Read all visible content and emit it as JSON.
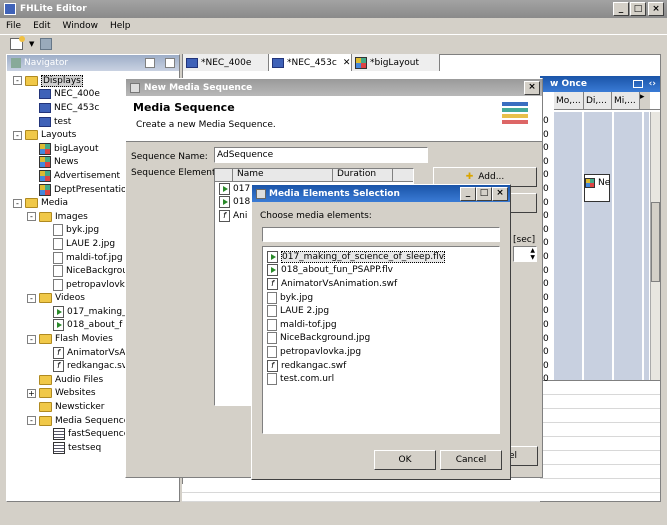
{
  "app_title": "FHLite Editor",
  "menu": [
    "File",
    "Edit",
    "Window",
    "Help"
  ],
  "navigator_label": "Navigator",
  "tree": [
    {
      "label": "Displays",
      "indent": 0,
      "icon": "folder",
      "exp": "-",
      "sel": true
    },
    {
      "label": "NEC_400e",
      "indent": 1,
      "icon": "monitor"
    },
    {
      "label": "NEC_453c",
      "indent": 1,
      "icon": "monitor"
    },
    {
      "label": "test",
      "indent": 1,
      "icon": "monitor"
    },
    {
      "label": "Layouts",
      "indent": 0,
      "icon": "folder",
      "exp": "-"
    },
    {
      "label": "bigLayout",
      "indent": 1,
      "icon": "layout"
    },
    {
      "label": "News",
      "indent": 1,
      "icon": "layout"
    },
    {
      "label": "Advertisement",
      "indent": 1,
      "icon": "layout"
    },
    {
      "label": "DeptPresentation",
      "indent": 1,
      "icon": "layout"
    },
    {
      "label": "Media",
      "indent": 0,
      "icon": "folder",
      "exp": "-"
    },
    {
      "label": "Images",
      "indent": 1,
      "icon": "folder",
      "exp": "-"
    },
    {
      "label": "byk.jpg",
      "indent": 2,
      "icon": "doc"
    },
    {
      "label": "LAUE 2.jpg",
      "indent": 2,
      "icon": "doc"
    },
    {
      "label": "maldi-tof.jpg",
      "indent": 2,
      "icon": "doc"
    },
    {
      "label": "NiceBackgrou",
      "indent": 2,
      "icon": "doc"
    },
    {
      "label": "petropavlovk",
      "indent": 2,
      "icon": "doc"
    },
    {
      "label": "Videos",
      "indent": 1,
      "icon": "folder",
      "exp": "-"
    },
    {
      "label": "017_making_",
      "indent": 2,
      "icon": "vid"
    },
    {
      "label": "018_about_f",
      "indent": 2,
      "icon": "vid"
    },
    {
      "label": "Flash Movies",
      "indent": 1,
      "icon": "folder",
      "exp": "-"
    },
    {
      "label": "AnimatorVsAn",
      "indent": 2,
      "icon": "flash"
    },
    {
      "label": "redkangac.sv",
      "indent": 2,
      "icon": "flash"
    },
    {
      "label": "Audio Files",
      "indent": 1,
      "icon": "folder"
    },
    {
      "label": "Websites",
      "indent": 1,
      "icon": "folder",
      "exp": "+"
    },
    {
      "label": "Newsticker",
      "indent": 1,
      "icon": "folder"
    },
    {
      "label": "Media Sequences",
      "indent": 1,
      "icon": "folder",
      "exp": "-"
    },
    {
      "label": "fastSequence",
      "indent": 2,
      "icon": "seq"
    },
    {
      "label": "testseq",
      "indent": 2,
      "icon": "seq"
    }
  ],
  "editor_tabs": [
    "*NEC_400e",
    "*NEC_453c",
    "*bigLayout"
  ],
  "schedule": {
    "title": "w Once",
    "cols": [
      "Mo,...",
      "Di,...",
      "Mi,..."
    ],
    "cell_label": "Ne"
  },
  "row_zeros": [
    "0",
    "0",
    "0",
    "0",
    "0",
    "0",
    "0",
    "0",
    "0",
    "0",
    "0",
    "0",
    "0",
    "0",
    "0",
    "0",
    "0",
    "0",
    "0",
    "0"
  ],
  "new_seq": {
    "window_title": "New Media Sequence",
    "header": "Media Sequence",
    "subheader": "Create a new Media Sequence.",
    "name_label": "Sequence Name:",
    "name_value": "AdSequence",
    "elements_label": "Sequence Elements:",
    "col_name": "Name",
    "col_duration": "Duration",
    "rows": [
      "017",
      "018",
      "Ani"
    ],
    "add_label": "Add...",
    "sec_label": "[sec]",
    "cancel_partial": "el"
  },
  "sel_dialog": {
    "title": "Media Elements Selection",
    "prompt": "Choose media elements:",
    "filter_value": "",
    "items": [
      {
        "label": "017_making_of_science_of_sleep.flv",
        "icon": "vid",
        "sel": true
      },
      {
        "label": "018_about_fun_PSAPP.flv",
        "icon": "vid"
      },
      {
        "label": "AnimatorVsAnimation.swf",
        "icon": "flash"
      },
      {
        "label": "byk.jpg",
        "icon": "doc"
      },
      {
        "label": "LAUE 2.jpg",
        "icon": "doc"
      },
      {
        "label": "maldi-tof.jpg",
        "icon": "doc"
      },
      {
        "label": "NiceBackground.jpg",
        "icon": "doc"
      },
      {
        "label": "petropavlovka.jpg",
        "icon": "doc"
      },
      {
        "label": "redkangac.swf",
        "icon": "flash"
      },
      {
        "label": "test.com.url",
        "icon": "doc"
      }
    ],
    "ok": "OK",
    "cancel": "Cancel"
  }
}
